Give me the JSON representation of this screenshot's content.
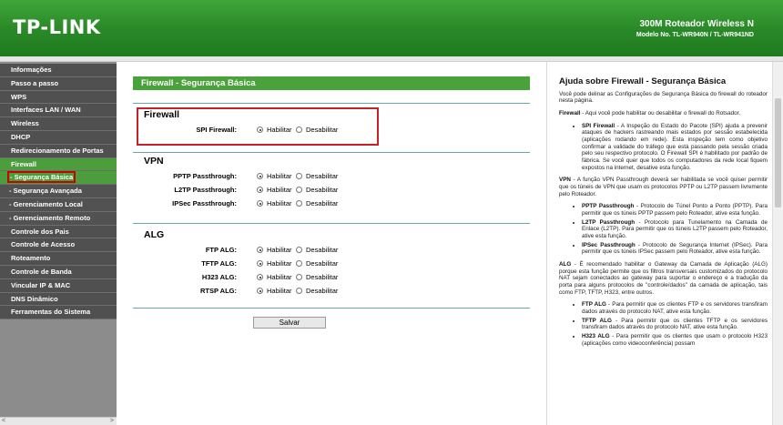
{
  "header": {
    "logo": "TP-LINK",
    "model_title": "300M Roteador Wireless N",
    "model_no": "Modelo No. TL-WR940N / TL-WR941ND"
  },
  "sidebar": {
    "items": [
      {
        "label": "Informações"
      },
      {
        "label": "Passo a passo"
      },
      {
        "label": "WPS"
      },
      {
        "label": "Interfaces LAN / WAN"
      },
      {
        "label": "Wireless"
      },
      {
        "label": "DHCP"
      },
      {
        "label": "Redirecionamento de Portas"
      },
      {
        "label": "Firewall"
      },
      {
        "label": "- Segurança Básica"
      },
      {
        "label": "- Segurança Avançada"
      },
      {
        "label": "- Gerenciamento Local"
      },
      {
        "label": "- Gerenciamento Remoto"
      },
      {
        "label": "Controle dos Pais"
      },
      {
        "label": "Controle de Acesso"
      },
      {
        "label": "Roteamento"
      },
      {
        "label": "Controle de Banda"
      },
      {
        "label": "Vincular IP & MAC"
      },
      {
        "label": "DNS Dinâmico"
      },
      {
        "label": "Ferramentas do Sistema"
      }
    ],
    "scroll_left": "<",
    "scroll_right": ">"
  },
  "main": {
    "title": "Firewall - Segurança Básica",
    "enable_label": "Habilitar",
    "disable_label": "Desabilitar",
    "firewall": {
      "title": "Firewall",
      "rows": [
        {
          "label": "SPI Firewall:"
        }
      ]
    },
    "vpn": {
      "title": "VPN",
      "rows": [
        {
          "label": "PPTP Passthrough:"
        },
        {
          "label": "L2TP Passthrough:"
        },
        {
          "label": "IPSec Passthrough:"
        }
      ]
    },
    "alg": {
      "title": "ALG",
      "rows": [
        {
          "label": "FTP ALG:"
        },
        {
          "label": "TFTP ALG:"
        },
        {
          "label": "H323 ALG:"
        },
        {
          "label": "RTSP ALG:"
        }
      ]
    },
    "save_label": "Salvar"
  },
  "help": {
    "title": "Ajuda sobre Firewall - Segurança Básica",
    "intro": "Você pode delinar as Configurações de Segurança Básica do firewall do roteador nesta página.",
    "firewall_term": "Firewall",
    "firewall_text": " - Aqui você pode habilitar ou desabilitar o firewall do Rotsador.",
    "spi_term": "SPI Firewall",
    "spi_text": " - A Inspeção do Estado do Pacote (SPI) ajuda a prevenir ataques de hackers rastreando mais estados por sessão estabelecida (aplicações rodando em rede). Esta inspeção tem como objetivo confirmar a validade do tráfego que está passando pela sessão criada pelo seu respectivo protocolo. O Firewall SPI é habilitado por padrão de fábrica. Se você quer que todos os computadores da rede local fiquem expostos na internet, desative esta função.",
    "vpn_term": "VPN",
    "vpn_text": " - A função VPN Passthrough deverá ser habilitada se você quiser permitir que os túneis de VPN que usam os protocolos PPTP ou L2TP passem livremente pelo Roteador.",
    "pptp_term": "PPTP Passthrough",
    "pptp_text": " - Protocolo de Túnel Ponto a Ponto (PPTP). Para permitir que os túneis PPTP passem pelo Roteador, ative esta função.",
    "l2tp_term": "L2TP Passthrough",
    "l2tp_text": " - Protocolo para Tunelamento na Camada de Enlace (L2TP). Para permitir que os túneis L2TP passem pelo Roteador, ative esta função.",
    "ipsec_term": "IPSec Passthrough",
    "ipsec_text": " - Protocolo de Segurança Internet (IPSec). Para permitir que os túneis IPSec passem pelo Roteador, ative esta função.",
    "alg_term": "ALG",
    "alg_text": " - É recomendado habilitar o Gateway da Camada de Aplicação (ALG) porque esta função permite que os filtros transversais customizados do protocolo NAT sejam conectados ao gateway para suportar o endereço e a tradução da porta para alguns protocolos de \"controle/dados\" da camada de aplicação, tais como FTP, TFTP, H323, entre outros.",
    "ftp_term": "FTP ALG",
    "ftp_text": " - Para permitir que os clientes FTP e os servidores transfiram dados através do protocolo NAT, ative esta função.",
    "tftp_term": "TFTP ALG",
    "tftp_text": " - Para permitir que os clientes TFTP e os servidores transfiram dados através do protocolo NAT, ative esta função.",
    "h323_term": "H323 ALG",
    "h323_text": " - Para permitir que os clientes que usam o protocolo H323 (aplicações como videoconferência) possam"
  }
}
